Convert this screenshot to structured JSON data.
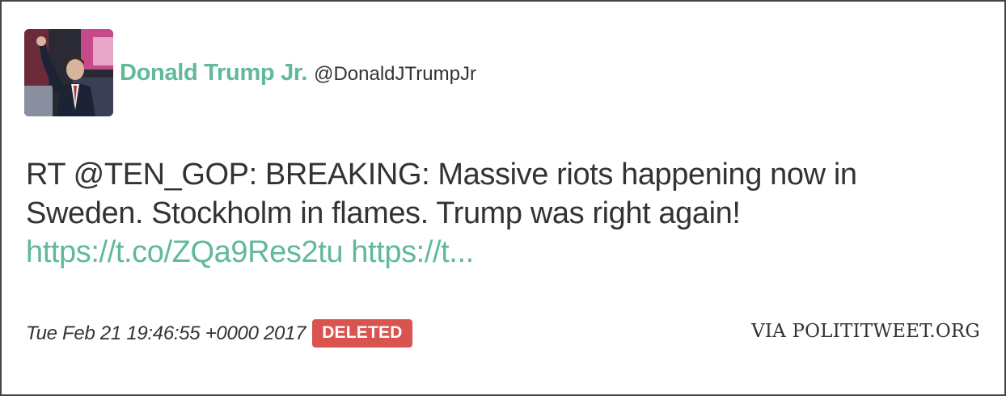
{
  "user": {
    "display_name": "Donald Trump Jr.",
    "handle": "@DonaldJTrumpJr",
    "avatar_icon": "profile-photo"
  },
  "tweet": {
    "text_line": "RT @TEN_GOP: BREAKING: Massive riots happening now in Sweden. Stockholm in flames. Trump was right again!",
    "link1": "https://t.co/ZQa9Res2tu",
    "link2": "https://t..."
  },
  "footer": {
    "timestamp": "Tue Feb 21 19:46:55 +0000 2017",
    "status_badge": "DELETED",
    "source": "VIA POLITITWEET.ORG"
  },
  "colors": {
    "accent": "#5fb99a",
    "badge": "#d9534f",
    "text": "#333333"
  }
}
